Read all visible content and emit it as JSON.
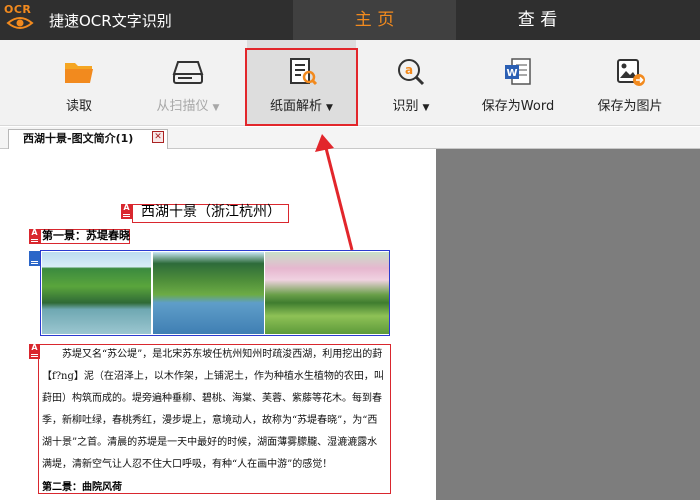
{
  "app": {
    "logo_text": "OCR",
    "title": "捷速OCR文字识别"
  },
  "nav": {
    "tabs": [
      {
        "label": "主 页",
        "active": true
      },
      {
        "label": "查 看",
        "active": false
      }
    ]
  },
  "toolbar": {
    "read_label": "读取",
    "scan_label": "从扫描仪",
    "parse_label": "纸面解析",
    "recognize_label": "识别",
    "save_word_label": "保存为Word",
    "save_image_label": "保存为图片",
    "dropdown_caret": "▼"
  },
  "doc_tab": {
    "title": "西湖十景-图文简介(1)",
    "close_glyph": "✕"
  },
  "document": {
    "marker_text": "A",
    "title": "西湖十景（浙江杭州）",
    "subtitle1": "第一景：苏堤春晓",
    "paragraph": "苏堤又名“苏公堤”，是北宋苏东坡任杭州知州时疏浚西湖，利用挖出的葑【f?ng】泥（在沼泽上，以木作架，上铺泥土，作为种植水生植物的农田，叫葑田）构筑而成的。堤旁遍种垂柳、碧桃、海棠、芙蓉、紫藤等花木。每到春季，新柳吐绿，春桃秀红，漫步堤上，意境动人，故称为“苏堤春晓”，为“西湖十景”之首。清晨的苏堤是一天中最好的时候，湖面薄雾朦朧、湿漉漉露水满堤，清新空气让人忍不住大口呼吸，有种“人在画中游”的感觉！",
    "subtitle2": "第二景：曲院风荷"
  },
  "colors": {
    "accent_orange": "#f28a1e",
    "highlight_red": "#e2262b",
    "titlebar_bg": "#2f2f2f",
    "preview_bg": "#7d7d7d"
  },
  "icons": [
    "folder-open-icon",
    "scanner-icon",
    "document-search-icon",
    "recognize-a-icon",
    "word-doc-icon",
    "save-image-icon",
    "close-icon"
  ]
}
